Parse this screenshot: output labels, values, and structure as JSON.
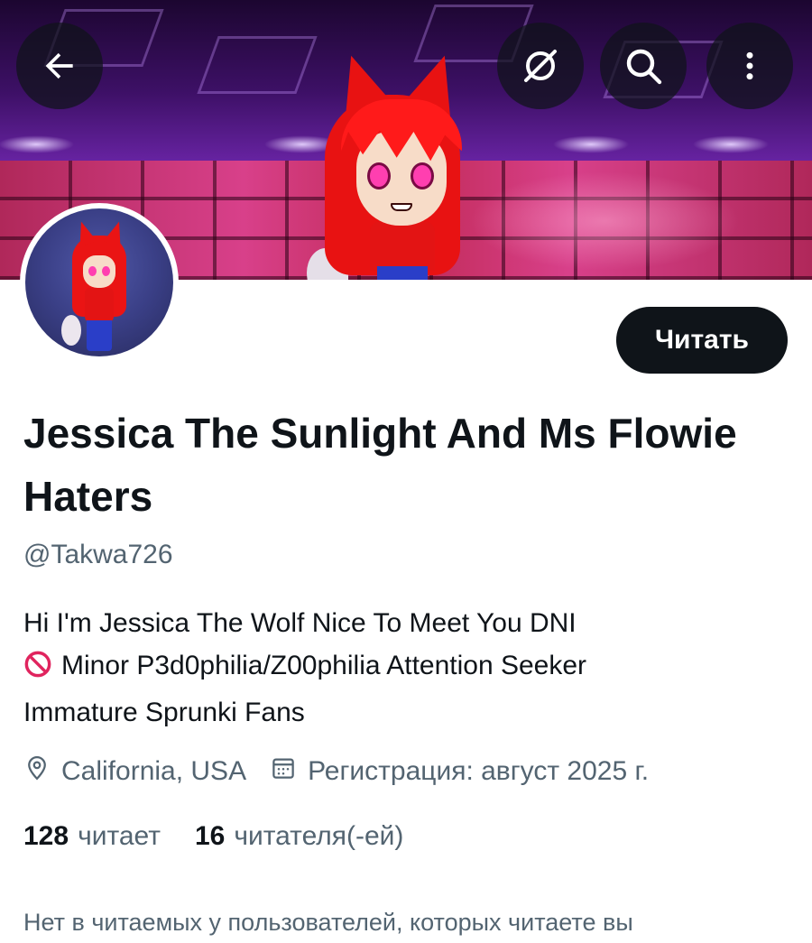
{
  "header": {
    "back_icon": "arrow-left-icon",
    "hide_icon": "eye-slash-icon",
    "search_icon": "search-icon",
    "more_icon": "more-vertical-icon"
  },
  "profile": {
    "display_name": "Jessica The Sunlight And Ms Flowie Haters",
    "handle": "@Takwa726",
    "follow_label": "Читать",
    "bio": {
      "line1": "Hi I'm Jessica The Wolf  Nice To Meet You  DNI",
      "line2": "Minor  P3d0philia/Z00philia Attention Seeker",
      "line3": "Immature Sprunki Fans"
    },
    "location": "California, USA",
    "joined": "Регистрация: август 2025 г.",
    "following_count": "128",
    "following_label": "читает",
    "followers_count": "16",
    "followers_label": "читателя(-ей)",
    "followers_you_know": "Нет в читаемых у пользователей, которых читаете вы"
  },
  "colors": {
    "primary_text": "#0f1419",
    "secondary_text": "#536471",
    "button_bg": "#0f1419",
    "prohibited": "#e0245e"
  }
}
